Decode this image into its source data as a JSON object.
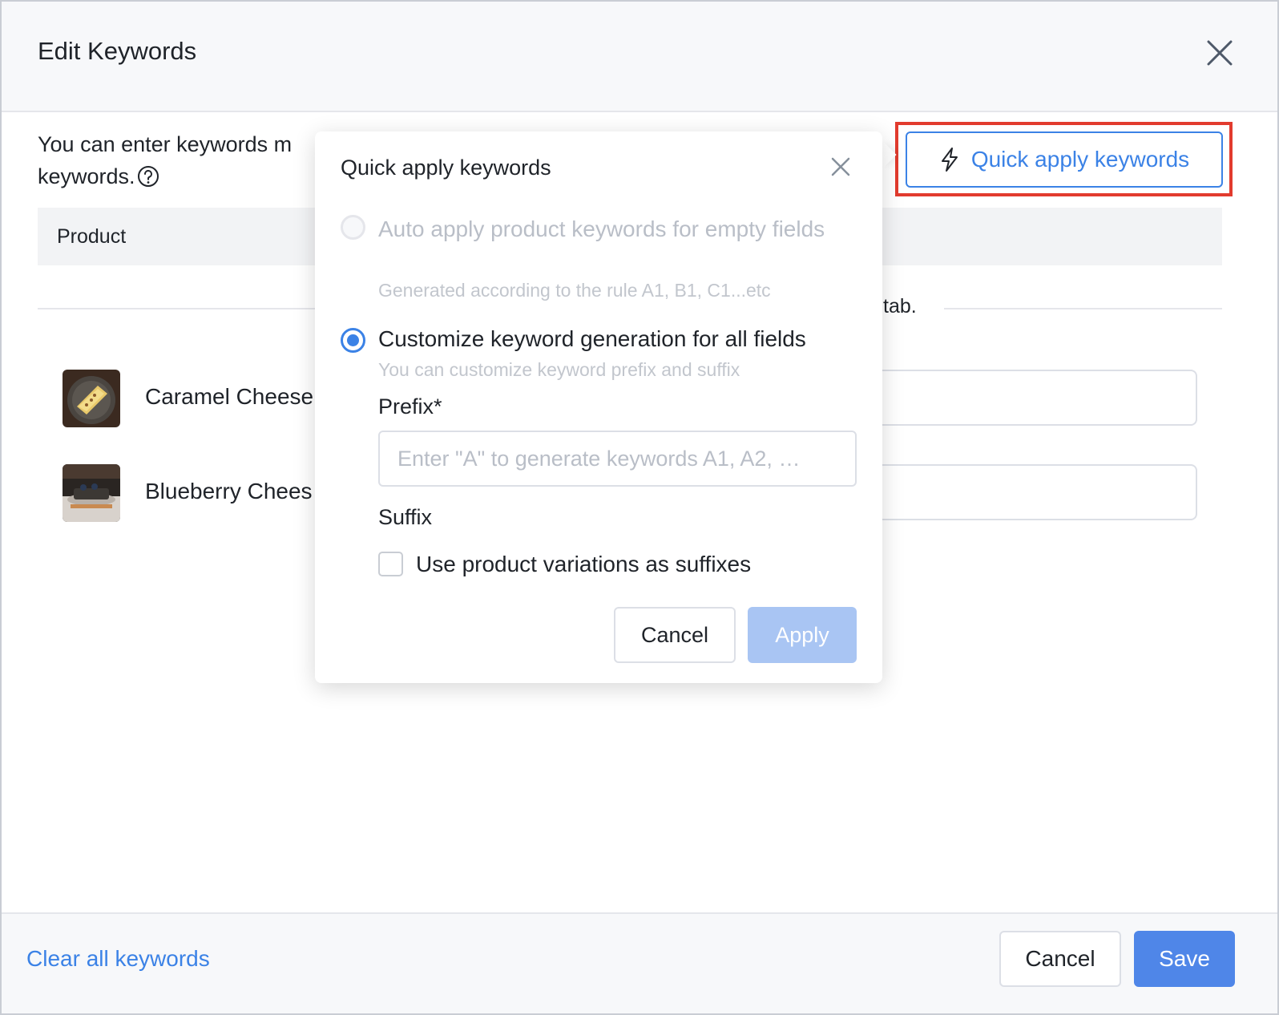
{
  "modal": {
    "title": "Edit Keywords",
    "intro_line1": "You can enter keywords m",
    "intro_line2": "keywords.",
    "quick_apply_button": "Quick apply keywords",
    "table_header": "Product",
    "tab_fragment": "tab.",
    "products": [
      {
        "name": "Caramel Cheese"
      },
      {
        "name": "Blueberry Chees"
      }
    ]
  },
  "popover": {
    "title": "Quick apply keywords",
    "option1": {
      "label": "Auto apply product keywords for empty fields",
      "sub": "Generated according to the rule A1, B1, C1...etc",
      "disabled": true
    },
    "option2": {
      "label": "Customize keyword generation for all fields",
      "sub": "You can customize keyword prefix and suffix",
      "checked": true
    },
    "prefix_label": "Prefix*",
    "prefix_placeholder": "Enter \"A\" to generate keywords A1, A2, …",
    "suffix_label": "Suffix",
    "suffix_checkbox_label": "Use product variations as suffixes",
    "cancel": "Cancel",
    "apply": "Apply"
  },
  "footer": {
    "clear_link": "Clear all keywords",
    "cancel": "Cancel",
    "save": "Save"
  },
  "colors": {
    "accent": "#3b82e6",
    "highlight": "#e23b2e",
    "save_bg": "#4f86e8",
    "apply_disabled_bg": "#a9c5f3"
  }
}
